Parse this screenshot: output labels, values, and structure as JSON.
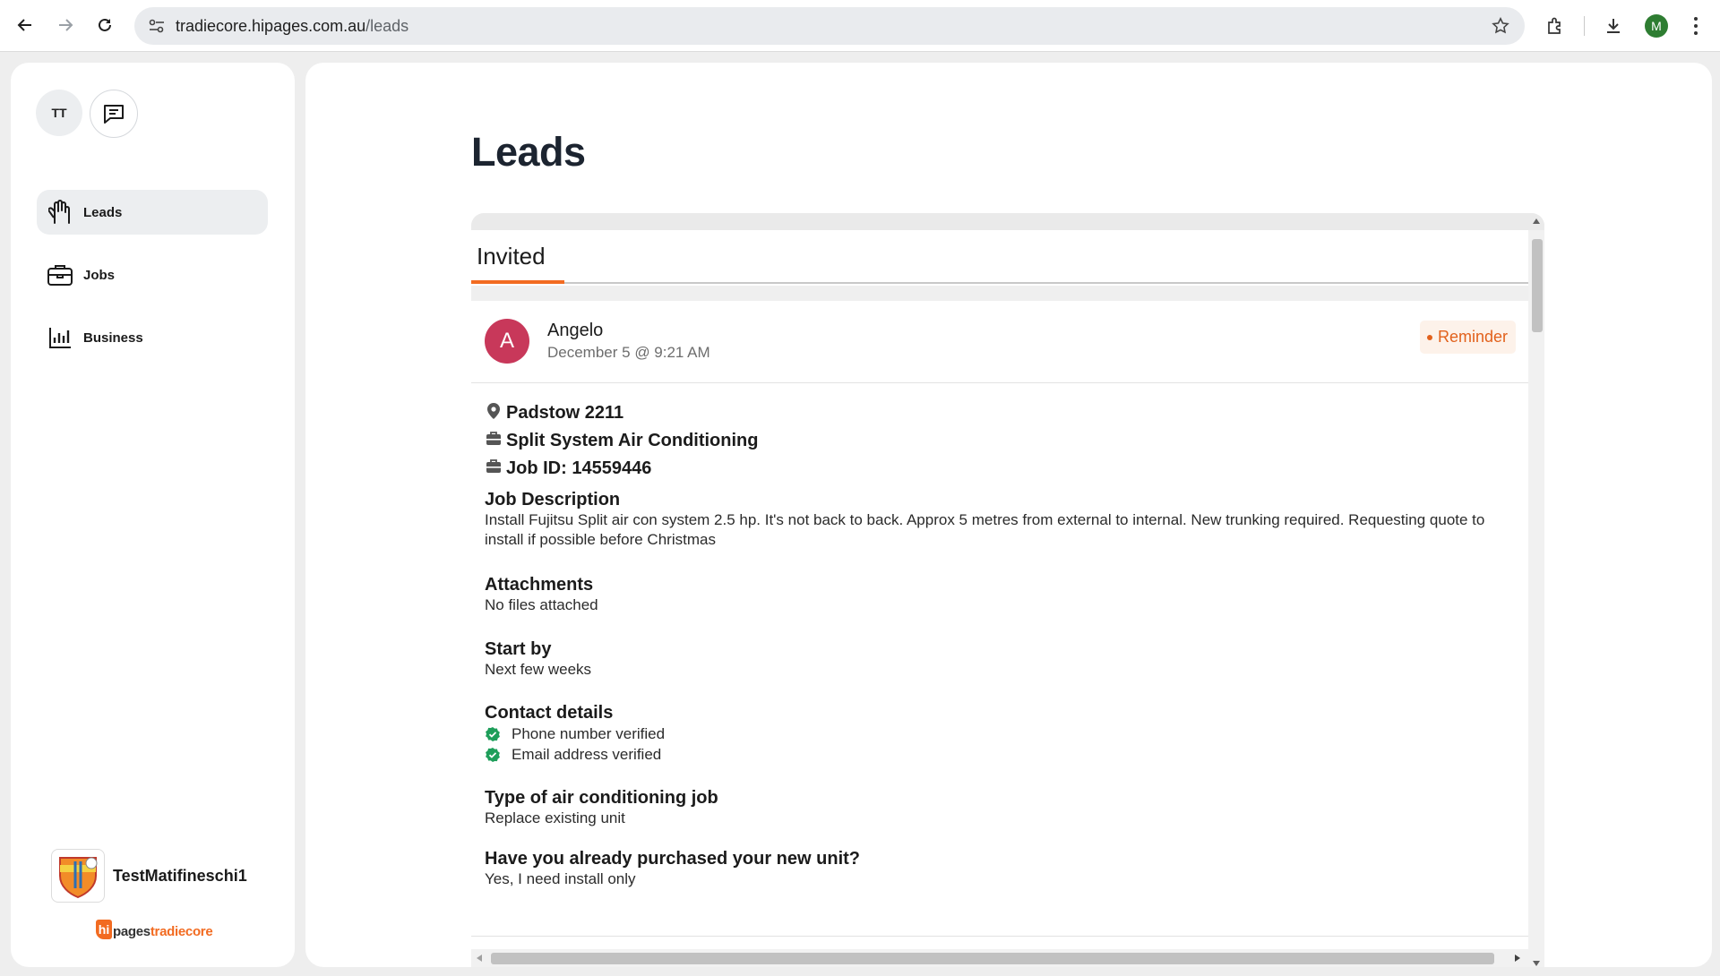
{
  "browser": {
    "url_host": "tradiecore.hipages.com.au",
    "url_path": "/leads",
    "profile_initial": "M",
    "profile_color": "#2e7d32"
  },
  "sidebar": {
    "user_initials": "TT",
    "items": [
      {
        "label": "Leads",
        "icon": "hand-icon",
        "active": true
      },
      {
        "label": "Jobs",
        "icon": "briefcase-icon",
        "active": false
      },
      {
        "label": "Business",
        "icon": "bar-chart-icon",
        "active": false
      }
    ],
    "business_name": "TestMatifineschi1",
    "brand": {
      "hi": "hi",
      "part1": "pages",
      "part2": "tradiecore"
    }
  },
  "main": {
    "title": "Leads",
    "tabs": [
      {
        "label": "Invited",
        "active": true
      }
    ],
    "lead": {
      "avatar_initial": "A",
      "avatar_color": "#c8385a",
      "name": "Angelo",
      "date": "December 5 @ 9:21 AM",
      "badge": "Reminder",
      "location": "Padstow 2211",
      "category": "Split System Air Conditioning",
      "job_id": "Job ID: 14559446",
      "sections": {
        "description_title": "Job Description",
        "description": "Install Fujitsu Split air con system 2.5 hp. It's not back to back. Approx 5 metres from external to internal. New trunking required. Requesting quote to install if possible before Christmas",
        "attachments_title": "Attachments",
        "attachments": "No files attached",
        "start_title": "Start by",
        "start": "Next few weeks",
        "contact_title": "Contact details",
        "contact_phone": "Phone number verified",
        "contact_email": "Email address verified",
        "type_title": "Type of air conditioning job",
        "type": "Replace existing unit",
        "purchased_title": "Have you already purchased your new unit?",
        "purchased": "Yes, I need install only"
      }
    }
  },
  "colors": {
    "accent": "#f26b21",
    "verified": "#1e9e5a"
  }
}
